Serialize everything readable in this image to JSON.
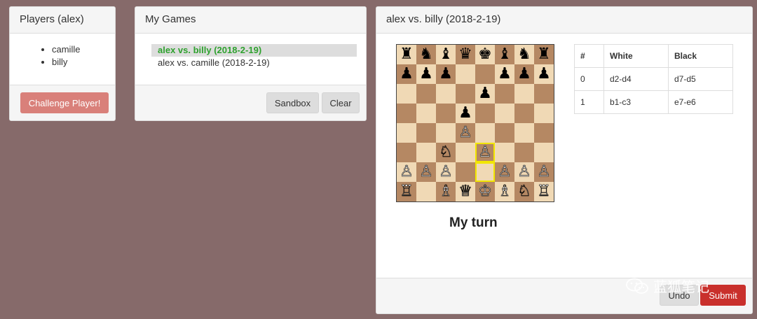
{
  "players_panel": {
    "title": "Players (alex)",
    "players": [
      "camille",
      "billy"
    ],
    "challenge_label": "Challenge Player!"
  },
  "games_panel": {
    "title": "My Games",
    "games": [
      {
        "label": "alex vs. billy (2018-2-19)",
        "active": true
      },
      {
        "label": "alex vs. camille (2018-2-19)",
        "active": false
      }
    ],
    "sandbox_label": "Sandbox",
    "clear_label": "Clear"
  },
  "game_panel": {
    "title": "alex vs. billy (2018-2-19)",
    "turn_text": "My turn",
    "undo_label": "Undo",
    "submit_label": "Submit",
    "board": [
      "rnbqkbnr",
      "ppp..ppp",
      "....p...",
      "...p....",
      "...P....",
      "..N.P...",
      "PPP..PPP",
      "R.BQKBNR"
    ],
    "highlight_squares": [
      "e3",
      "e2"
    ],
    "moves_table": {
      "headers": [
        "#",
        "White",
        "Black"
      ],
      "rows": [
        {
          "num": "0",
          "white": "d2-d4",
          "black": "d7-d5"
        },
        {
          "num": "1",
          "white": "b1-c3",
          "black": "e7-e6"
        }
      ]
    }
  },
  "watermark": {
    "text": "蓝狐笔记",
    "icon": "wechat-icon"
  },
  "colors": {
    "background": "#866a6a",
    "active_game": "#2ea12e",
    "light_square": "#f0d9b5",
    "dark_square": "#b58863",
    "submit": "#c9302c"
  }
}
